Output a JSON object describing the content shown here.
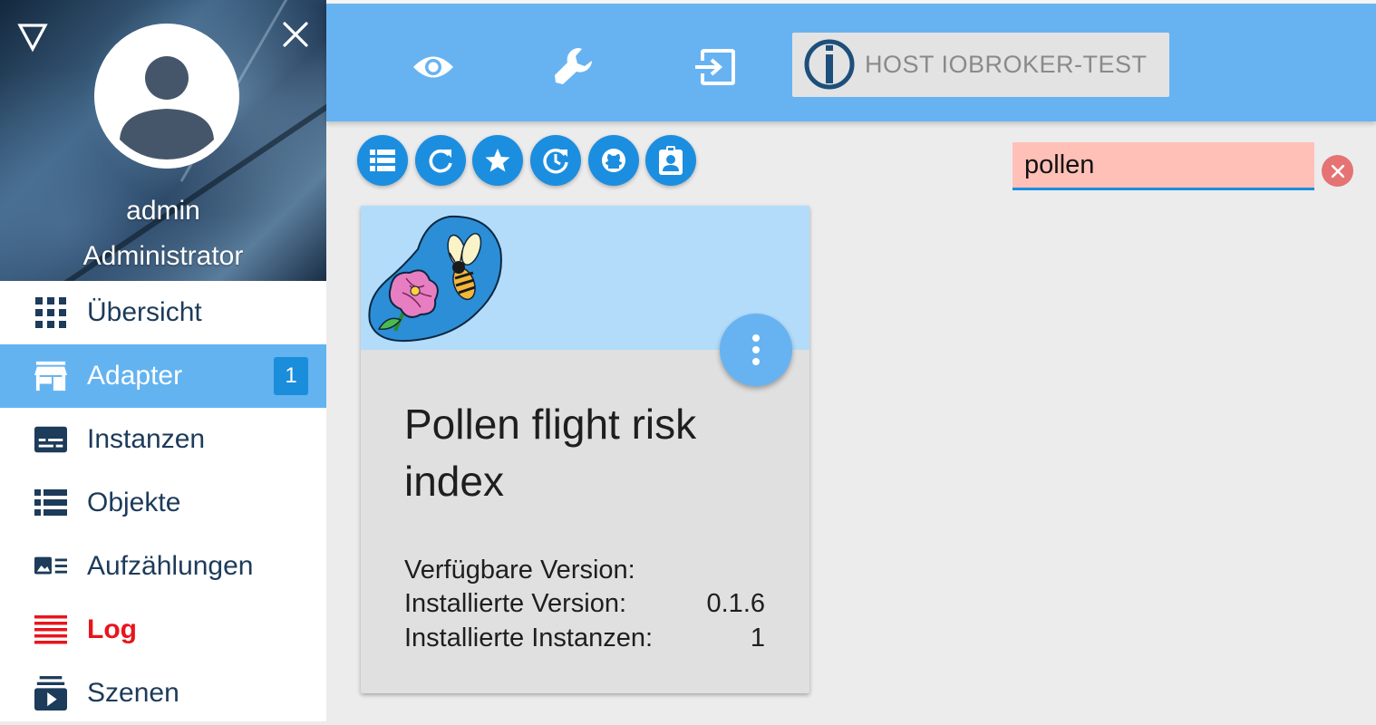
{
  "user": {
    "name": "admin",
    "role": "Administrator"
  },
  "nav": {
    "items": [
      {
        "label": "Übersicht",
        "icon": "grid-icon"
      },
      {
        "label": "Adapter",
        "icon": "store-icon",
        "badge": "1",
        "active": true
      },
      {
        "label": "Instanzen",
        "icon": "subtitles-icon"
      },
      {
        "label": "Objekte",
        "icon": "list-icon"
      },
      {
        "label": "Aufzählungen",
        "icon": "image-list-icon"
      },
      {
        "label": "Log",
        "icon": "lines-icon",
        "color": "#e8141c"
      },
      {
        "label": "Szenen",
        "icon": "subscriptions-icon"
      }
    ]
  },
  "toolbar": {
    "icons": [
      "eye-icon",
      "wrench-icon",
      "exit-icon"
    ],
    "host_label": "HOST IOBROKER-TEST"
  },
  "actions": {
    "icons": [
      "list-view-icon",
      "refresh-icon",
      "star-icon",
      "update-icon",
      "github-icon",
      "clipboard-account-icon"
    ]
  },
  "search": {
    "value": "pollen"
  },
  "card": {
    "title": "Pollen flight risk index",
    "rows": [
      {
        "label": "Verfügbare Version:",
        "value": ""
      },
      {
        "label": "Installierte Version:",
        "value": "0.1.6"
      },
      {
        "label": "Installierte Instanzen:",
        "value": "1"
      }
    ]
  },
  "colors": {
    "accent": "#67b3f2",
    "primary_dark": "#1d3b5a",
    "fab": "#1c8ee0",
    "log": "#e8141c",
    "search_bg": "#ffc0b8"
  }
}
